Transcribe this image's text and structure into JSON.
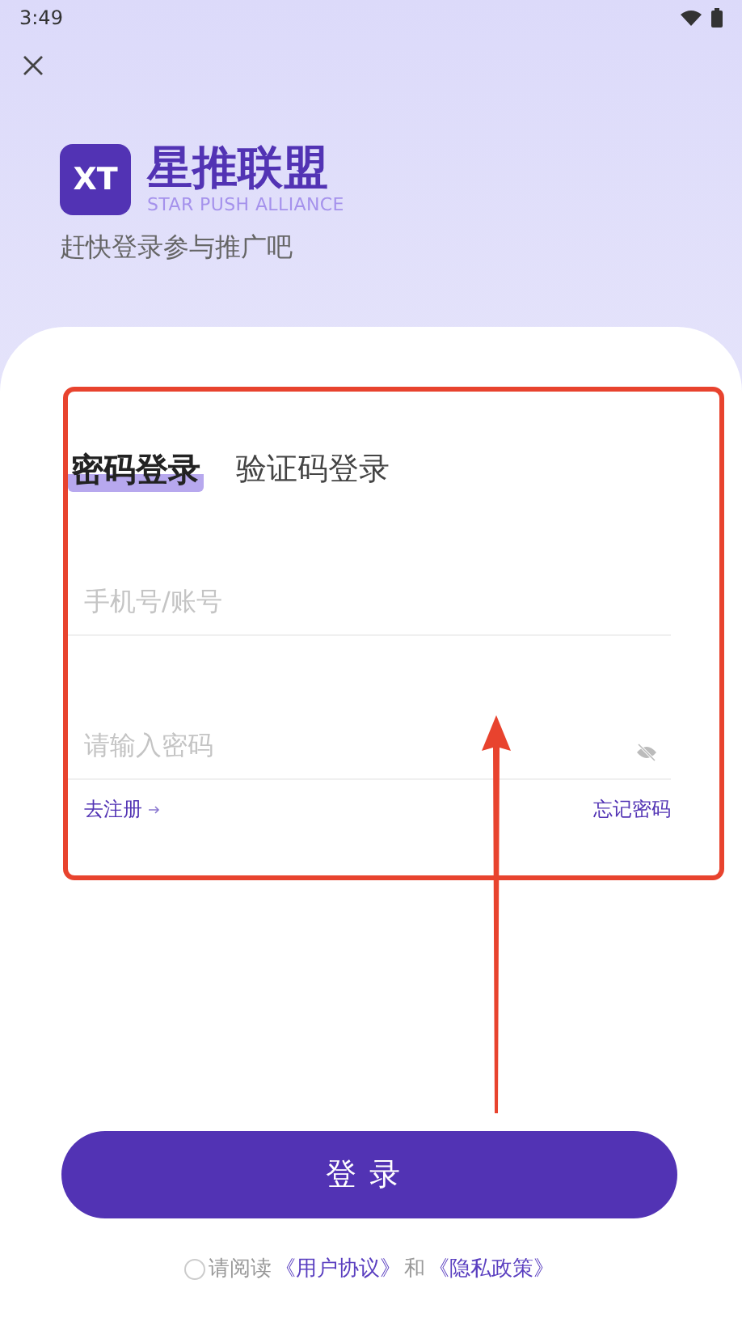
{
  "status_bar": {
    "time": "3:49"
  },
  "brand": {
    "logo": "XT",
    "name": "星推联盟",
    "tagline": "STAR PUSH ALLIANCE",
    "slogan": "赶快登录参与推广吧"
  },
  "tabs": [
    {
      "label": "密码登录",
      "selected": true
    },
    {
      "label": "验证码登录",
      "selected": false
    }
  ],
  "fields": [
    {
      "placeholder": "手机号/账号",
      "kind": "text"
    },
    {
      "placeholder": "请输入密码",
      "kind": "password"
    }
  ],
  "links": {
    "register": "去注册",
    "forgot": "忘记密码"
  },
  "login_button": "登录",
  "agreement": {
    "checked": false,
    "prefix": "请阅读",
    "terms": "《用户协议》",
    "joiner": "和",
    "privacy": "《隐私政策》"
  }
}
